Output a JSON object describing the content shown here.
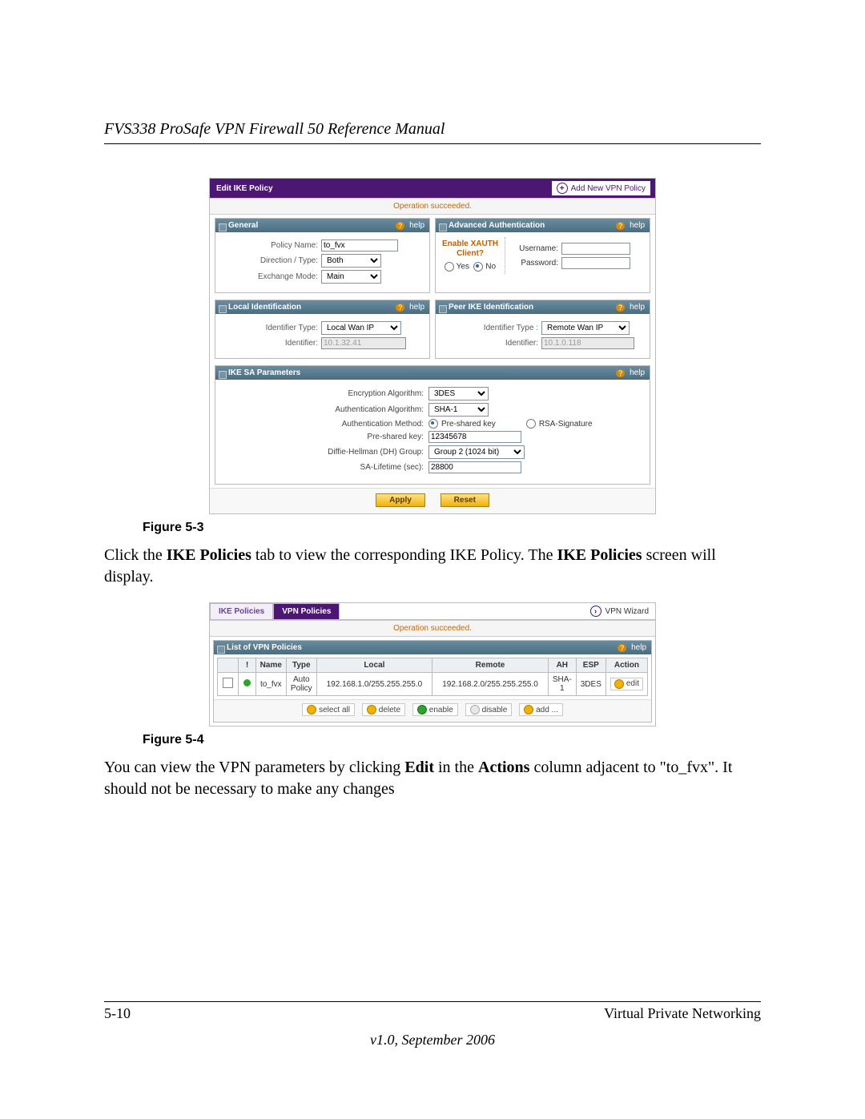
{
  "doc": {
    "title": "FVS338 ProSafe VPN Firewall 50 Reference Manual",
    "page_num": "5-10",
    "section": "Virtual Private Networking",
    "version": "v1.0, September 2006"
  },
  "fig3_caption": "Figure 5-3",
  "fig4_caption": "Figure 5-4",
  "para1_a": "Click the ",
  "para1_b": "IKE Policies",
  "para1_c": " tab to view the corresponding IKE Policy. The ",
  "para1_d": "IKE Policies",
  "para1_e": " screen will display.",
  "para2_a": "You can view the VPN parameters by clicking ",
  "para2_b": "Edit",
  "para2_c": " in the ",
  "para2_d": "Actions",
  "para2_e": " column adjacent to \"to_fvx\". It should not be necessary to make any changes",
  "s1": {
    "title": "Edit IKE Policy",
    "add_link": "Add New VPN Policy",
    "msg": "Operation succeeded.",
    "help": "help",
    "general": {
      "hdr": "General",
      "policy_lbl": "Policy Name:",
      "policy_val": "to_fvx",
      "dir_lbl": "Direction / Type:",
      "dir_val": "Both",
      "mode_lbl": "Exchange Mode:",
      "mode_val": "Main"
    },
    "auth": {
      "hdr": "Advanced Authentication",
      "enable_a": "Enable XAUTH",
      "enable_b": "Client?",
      "yes": "Yes",
      "no": "No",
      "user_lbl": "Username:",
      "pass_lbl": "Password:"
    },
    "local": {
      "hdr": "Local Identification",
      "type_lbl": "Identifier Type:",
      "type_val": "Local Wan IP",
      "id_lbl": "Identifier:",
      "id_val": "10.1.32.41"
    },
    "peer": {
      "hdr": "Peer IKE Identification",
      "type_lbl": "Identifier Type :",
      "type_val": "Remote Wan IP",
      "id_lbl": "Identifier:",
      "id_val": "10.1.0.118"
    },
    "sa": {
      "hdr": "IKE SA Parameters",
      "enc_lbl": "Encryption Algorithm:",
      "enc_val": "3DES",
      "auth_lbl": "Authentication Algorithm:",
      "auth_val": "SHA-1",
      "method_lbl": "Authentication Method:",
      "psk": "Pre-shared key",
      "rsa": "RSA-Signature",
      "psk_lbl": "Pre-shared key:",
      "psk_val": "12345678",
      "dh_lbl": "Diffie-Hellman (DH) Group:",
      "dh_val": "Group 2 (1024 bit)",
      "life_lbl": "SA-Lifetime (sec):",
      "life_val": "28800"
    },
    "apply": "Apply",
    "reset": "Reset"
  },
  "s2": {
    "tab1": "IKE Policies",
    "tab2": "VPN Policies",
    "wizard": "VPN Wizard",
    "msg": "Operation succeeded.",
    "list_hdr": "List of VPN Policies",
    "help": "help",
    "cols": {
      "c1": "!",
      "c2": "Name",
      "c3": "Type",
      "c4": "Local",
      "c5": "Remote",
      "c6": "AH",
      "c7": "ESP",
      "c8": "Action"
    },
    "row": {
      "name": "to_fvx",
      "type": "Auto Policy",
      "local": "192.168.1.0/255.255.255.0",
      "remote": "192.168.2.0/255.255.255.0",
      "ah": "SHA-1",
      "esp": "3DES",
      "action": "edit"
    },
    "btns": {
      "sel": "select all",
      "del": "delete",
      "en": "enable",
      "dis": "disable",
      "add": "add ..."
    }
  }
}
